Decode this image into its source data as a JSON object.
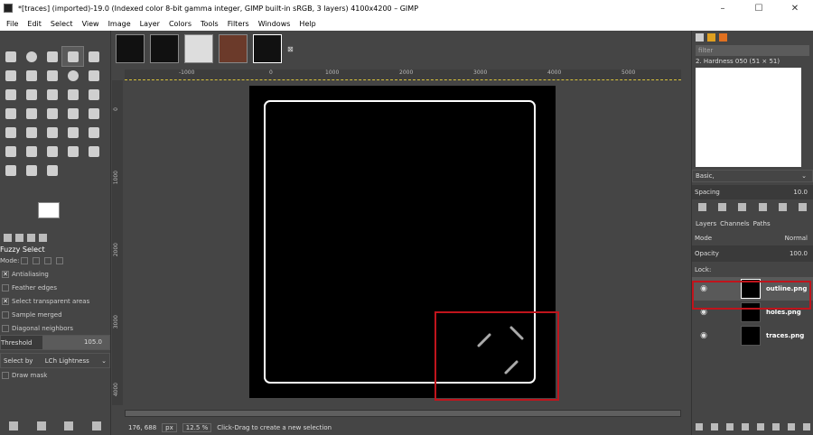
{
  "window": {
    "title": "*[traces] (imported)-19.0 (Indexed color 8-bit gamma integer, GIMP built-in sRGB, 3 layers) 4100x4200 – GIMP",
    "minimize": "–",
    "maximize": "☐",
    "close": "✕"
  },
  "menu": [
    "File",
    "Edit",
    "Select",
    "View",
    "Image",
    "Layer",
    "Colors",
    "Tools",
    "Filters",
    "Windows",
    "Help"
  ],
  "tool_options": {
    "title": "Fuzzy Select",
    "mode_label": "Mode:",
    "antialiasing": "Antialiasing",
    "feather_edges": "Feather edges",
    "select_transparent": "Select transparent areas",
    "sample_merged": "Sample merged",
    "diagonal_neighbors": "Diagonal neighbors",
    "threshold_label": "Threshold",
    "threshold_value": "105.0",
    "select_by_label": "Select by",
    "select_by_value": "LCh Lightness",
    "draw_mask": "Draw mask"
  },
  "ruler": {
    "h_labels": [
      "-1000",
      "0",
      "1000",
      "2000",
      "3000",
      "4000",
      "5000"
    ],
    "v_labels": [
      "0",
      "1000",
      "2000",
      "3000",
      "4000"
    ]
  },
  "status": {
    "coords": "176, 688",
    "unit": "px",
    "zoom": "12.5 %",
    "message": "Click-Drag to create a new selection"
  },
  "brushes": {
    "filter_placeholder": "filter",
    "current": "2. Hardness 050 (51 × 51)",
    "preset": "Basic,",
    "spacing_label": "Spacing",
    "spacing_value": "10.0"
  },
  "layers_panel": {
    "tabs": [
      "Layers",
      "Channels",
      "Paths"
    ],
    "mode_label": "Mode",
    "mode_value": "Normal",
    "opacity_label": "Opacity",
    "opacity_value": "100.0",
    "lock_label": "Lock:",
    "layers": [
      {
        "name": "outline.png",
        "visible": true,
        "active": true
      },
      {
        "name": "holes.png",
        "visible": true,
        "active": false
      },
      {
        "name": "traces.png",
        "visible": true,
        "active": false
      }
    ]
  },
  "colors": {
    "highlight": "#c0141c",
    "canvas": "#000000",
    "outline": "#ffffff"
  }
}
